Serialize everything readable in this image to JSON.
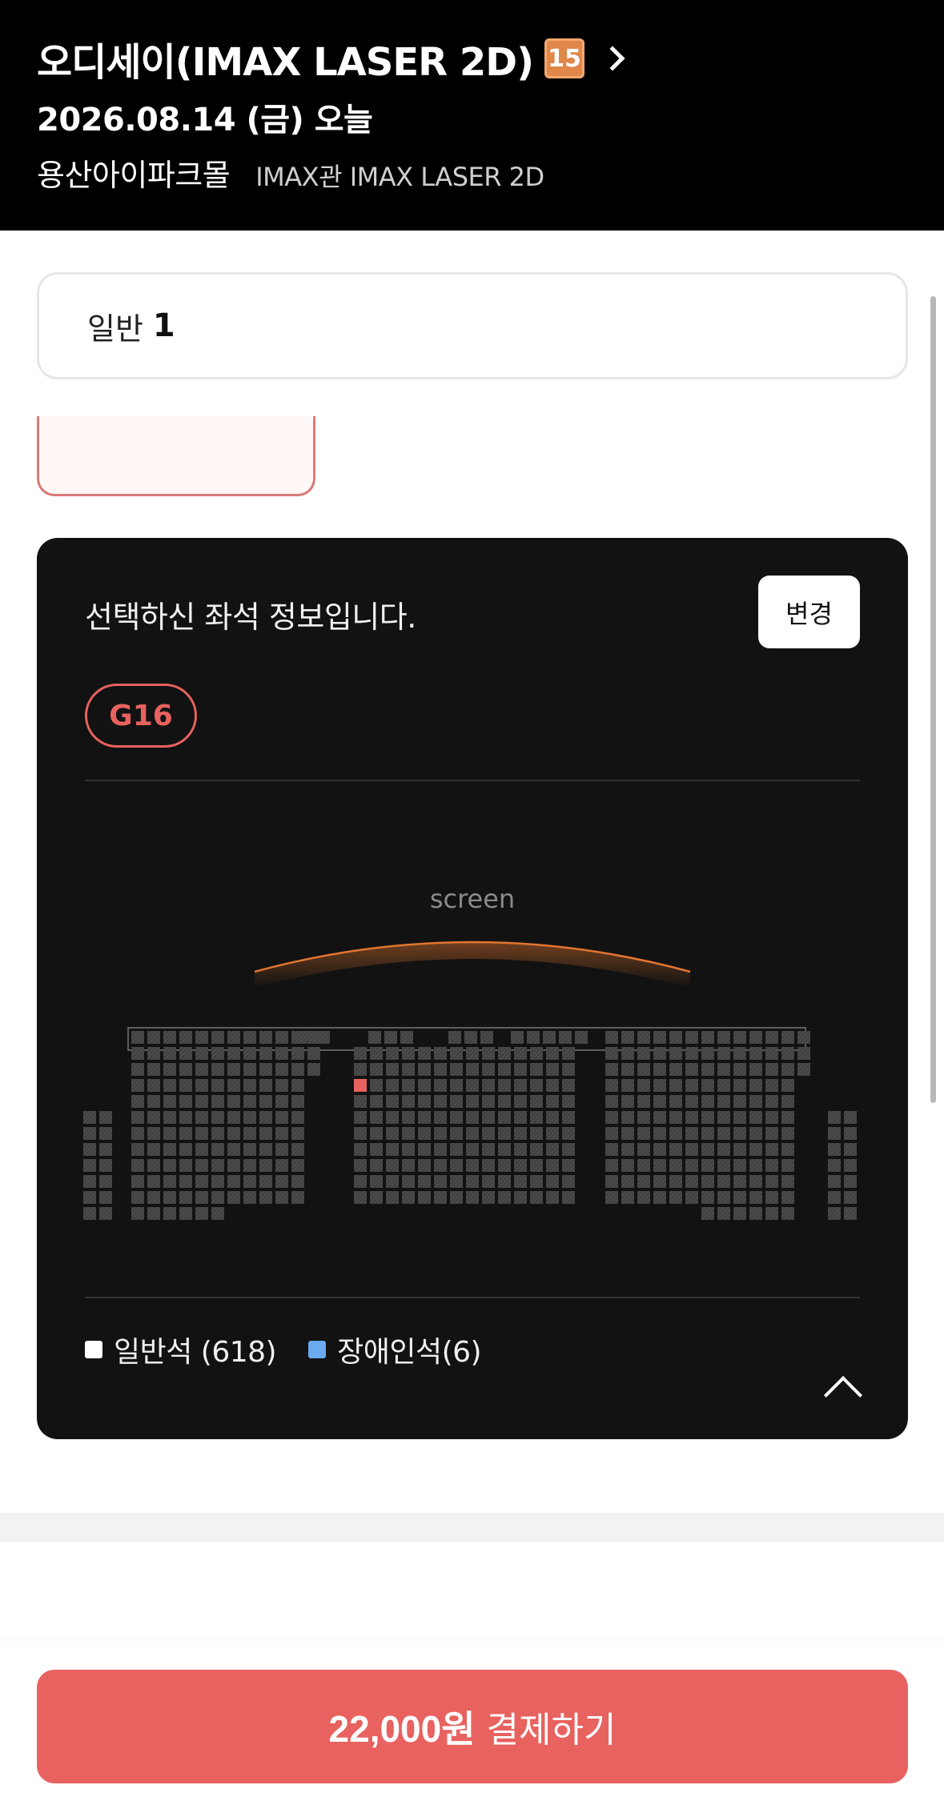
{
  "header": {
    "title": "오디세이(IMAX LASER 2D)",
    "rating": "15",
    "date": "2026.08.14 (금) 오늘",
    "theater": "용산아이파크몰",
    "screen": "IMAX관 IMAX LASER 2D"
  },
  "ticket": {
    "label": "일반",
    "count": "1"
  },
  "seat_info": {
    "message": "선택하신 좌석 정보입니다.",
    "change_label": "변경",
    "selected_seat": "G16",
    "screen_label": "screen",
    "legend": [
      {
        "label": "일반석 (618)",
        "color": "#ffffff"
      },
      {
        "label": "장애인석(6)",
        "color": "#6aaaf0"
      }
    ]
  },
  "payment": {
    "price": "22,000원",
    "label": "결제하기"
  },
  "colors": {
    "accent": "#e8625f",
    "header_bg": "#000000",
    "card_bg": "#121212",
    "seat": "#4a4a4a",
    "selected_seat": "#e8625f"
  }
}
